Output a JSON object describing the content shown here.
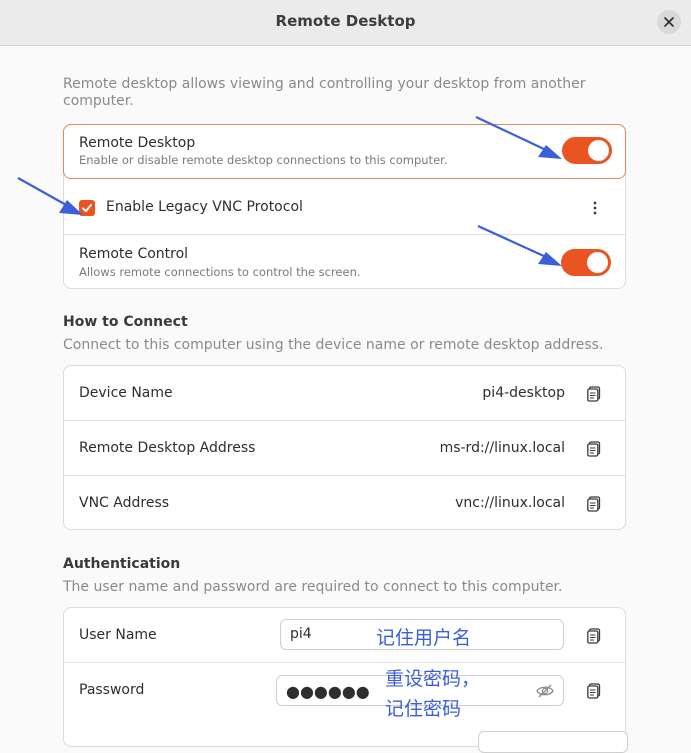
{
  "window": {
    "title": "Remote Desktop"
  },
  "intro": "Remote desktop allows viewing and controlling your desktop from another computer.",
  "remote_desktop": {
    "title": "Remote Desktop",
    "subtitle": "Enable or disable remote desktop connections to this computer.",
    "enabled": true
  },
  "legacy_vnc": {
    "label": "Enable Legacy VNC Protocol",
    "checked": true
  },
  "remote_control": {
    "title": "Remote Control",
    "subtitle": "Allows remote connections to control the screen.",
    "enabled": true
  },
  "how_to_connect": {
    "title": "How to Connect",
    "subtitle": "Connect to this computer using the device name or remote desktop address.",
    "rows": [
      {
        "label": "Device Name",
        "value": "pi4-desktop"
      },
      {
        "label": "Remote Desktop Address",
        "value": "ms-rd://linux.local"
      },
      {
        "label": "VNC Address",
        "value": "vnc://linux.local"
      }
    ]
  },
  "authentication": {
    "title": "Authentication",
    "subtitle": "The user name and password are required to connect to this computer.",
    "username_label": "User Name",
    "username_value": "pi4",
    "password_label": "Password",
    "password_value": "●●●●●●"
  },
  "annotations": {
    "remember_username": "记住用户名",
    "reset_password_line1": "重设密码，",
    "reset_password_line2": "记住密码"
  },
  "colors": {
    "accent": "#e95420",
    "annotation": "#3a5fd9"
  }
}
